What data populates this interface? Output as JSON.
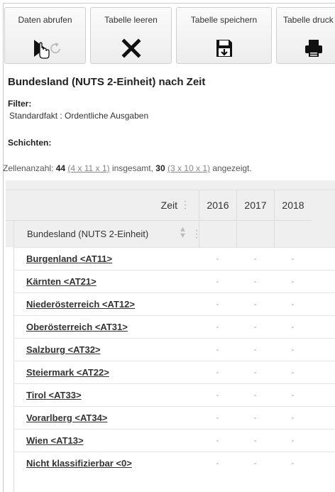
{
  "toolbar": {
    "fetch_label": "Daten abrufen",
    "clear_label": "Tabelle leeren",
    "save_label": "Tabelle speichern",
    "print_label": "Tabelle druck"
  },
  "title": "Bundesland (NUTS 2-Einheit) nach Zeit",
  "filter": {
    "heading": "Filter:",
    "value": "Standardfakt : Ordentliche Ausgaben"
  },
  "layers": {
    "heading": "Schichten:"
  },
  "cell_count": {
    "prefix": "Zellenanzahl: ",
    "total": "44",
    "total_dims": "(4 x 11 x 1)",
    "middle": " insgesamt, ",
    "shown": "30",
    "shown_dims": "(3 x 10 x 1)",
    "suffix": " angezeigt."
  },
  "table": {
    "column_dimension": "Zeit",
    "row_dimension": "Bundesland (NUTS 2-Einheit)",
    "years": [
      "2016",
      "2017",
      "2018"
    ],
    "rows": [
      {
        "name": "Burgenland <AT11>",
        "values": [
          "-",
          "-",
          "-"
        ]
      },
      {
        "name": "Kärnten <AT21>",
        "values": [
          "-",
          "-",
          "-"
        ]
      },
      {
        "name": "Niederösterreich <AT12>",
        "values": [
          "-",
          "-",
          "-"
        ]
      },
      {
        "name": "Oberösterreich <AT31>",
        "values": [
          "-",
          "-",
          "-"
        ]
      },
      {
        "name": "Salzburg <AT32>",
        "values": [
          "-",
          "-",
          "-"
        ]
      },
      {
        "name": "Steiermark <AT22>",
        "values": [
          "-",
          "-",
          "-"
        ]
      },
      {
        "name": "Tirol <AT33>",
        "values": [
          "-",
          "-",
          "-"
        ]
      },
      {
        "name": "Vorarlberg <AT34>",
        "values": [
          "-",
          "-",
          "-"
        ]
      },
      {
        "name": "Wien <AT13>",
        "values": [
          "-",
          "-",
          "-"
        ]
      },
      {
        "name": "Nicht klassifizierbar <0>",
        "values": [
          "-",
          "-",
          "-"
        ]
      }
    ]
  },
  "icons": {
    "fetch": "play-icon",
    "refresh": "refresh-icon",
    "clear": "close-icon",
    "save": "save-icon",
    "print": "printer-icon",
    "cursor": "hand-cursor-icon"
  }
}
